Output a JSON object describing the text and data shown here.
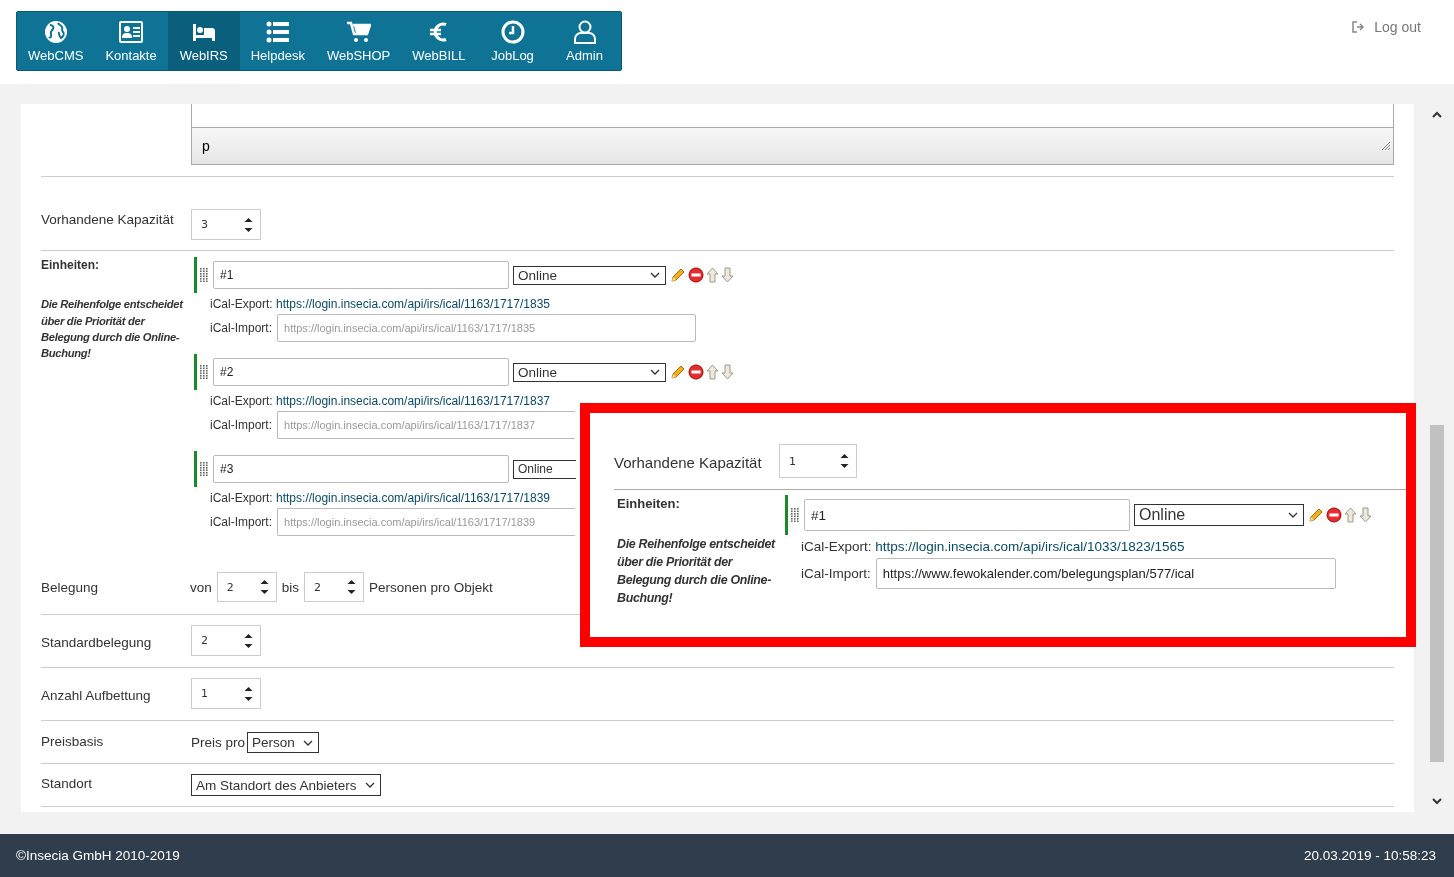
{
  "nav": {
    "items": [
      {
        "label": "WebCMS",
        "selected": false
      },
      {
        "label": "Kontakte",
        "selected": false
      },
      {
        "label": "WebIRS",
        "selected": true
      },
      {
        "label": "Helpdesk",
        "selected": false
      },
      {
        "label": "WebSHOP",
        "selected": false
      },
      {
        "label": "WebBILL",
        "selected": false
      },
      {
        "label": "JobLog",
        "selected": false
      },
      {
        "label": "Admin",
        "selected": false
      }
    ],
    "logout": "Log out"
  },
  "editor": {
    "path": "p"
  },
  "form": {
    "capacity": {
      "label": "Vorhandene Kapazität",
      "value": "3"
    },
    "units": {
      "label": "Einheiten:",
      "note": "Die Reihenfolge entscheidet über die Priorität der Belegung durch die Online-Buchung!",
      "items": [
        {
          "name": "#1",
          "status": "Online",
          "export_label": "iCal-Export:",
          "export_url": "https://login.insecia.com/api/irs/ical/1163/1717/1835",
          "import_label": "iCal-Import:",
          "import_placeholder": "https://login.insecia.com/api/irs/ical/1163/1717/1835"
        },
        {
          "name": "#2",
          "status": "Online",
          "export_label": "iCal-Export:",
          "export_url": "https://login.insecia.com/api/irs/ical/1163/1717/1837",
          "import_label": "iCal-Import:",
          "import_placeholder": "https://login.insecia.com/api/irs/ical/1163/1717/1837"
        },
        {
          "name": "#3",
          "status": "Online",
          "export_label": "iCal-Export:",
          "export_url": "https://login.insecia.com/api/irs/ical/1163/1717/1839",
          "import_label": "iCal-Import:",
          "import_placeholder": "https://login.insecia.com/api/irs/ical/1163/1717/1839"
        }
      ]
    },
    "occupancy": {
      "label": "Belegung",
      "from_label": "von",
      "from": "2",
      "to_label": "bis",
      "to": "2",
      "suffix": "Personen pro Objekt"
    },
    "standard": {
      "label": "Standardbelegung",
      "value": "2"
    },
    "extra_beds": {
      "label": "Anzahl Aufbettung",
      "value": "1"
    },
    "price_basis": {
      "label": "Preisbasis",
      "prefix": "Preis pro",
      "value": "Person"
    },
    "location": {
      "label": "Standort",
      "value": "Am Standort des Anbieters"
    }
  },
  "callout": {
    "capacity": {
      "label": "Vorhandene Kapazität",
      "value": "1"
    },
    "units": {
      "label": "Einheiten:",
      "note": "Die Reihenfolge entscheidet über die Priorität der Belegung durch die Online-Buchung!",
      "items": [
        {
          "name": "#1",
          "status": "Online",
          "export_label": "iCal-Export:",
          "export_url": "https://login.insecia.com/api/irs/ical/1033/1823/1565",
          "import_label": "iCal-Import:",
          "import_value": "https://www.fewokalender.com/belegungsplan/577/ical"
        }
      ]
    }
  },
  "footer": {
    "copyright": "©Insecia GmbH 2010-2019",
    "datetime": "20.03.2019 - 10:58:23"
  }
}
